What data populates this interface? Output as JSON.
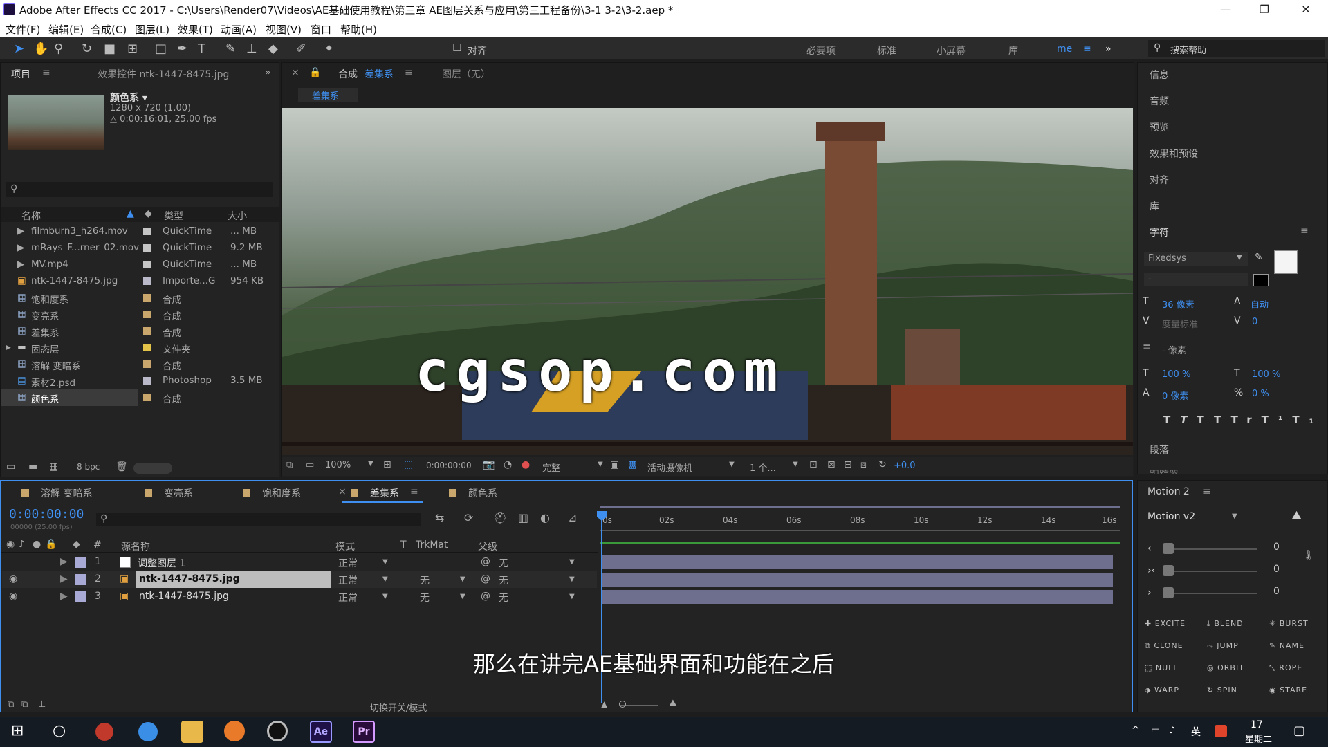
{
  "window": {
    "title": "Adobe After Effects CC 2017 - C:\\Users\\Render07\\Videos\\AE基础使用教程\\第三章 AE图层关系与应用\\第三工程备份\\3-1 3-2\\3-2.aep *",
    "minimize": "—",
    "restore": "❐",
    "close": "✕"
  },
  "menu": [
    "文件(F)",
    "编辑(E)",
    "合成(C)",
    "图层(L)",
    "效果(T)",
    "动画(A)",
    "视图(V)",
    "窗口",
    "帮助(H)"
  ],
  "toolbar": {
    "align_label": "对齐",
    "workspaces": [
      "必要项",
      "标准",
      "小屏幕",
      "库",
      "me"
    ],
    "search_placeholder": "搜索帮助"
  },
  "project": {
    "tab_label": "项目",
    "effects_tab": "效果控件 ntk-1447-8475.jpg",
    "preview_name": "颜色系 ▾",
    "preview_info1": "1280 x 720 (1.00)",
    "preview_info2": "△ 0:00:16:01, 25.00 fps",
    "col_name": "名称",
    "col_type": "类型",
    "col_size": "大小",
    "bpc": "8 bpc",
    "items": [
      {
        "name": "filmburn3_h264.mov",
        "type": "QuickTime",
        "size": "... MB",
        "color": "#a8a8a8"
      },
      {
        "name": "mRays_F...rner_02.mov",
        "type": "QuickTime",
        "size": "9.2 MB",
        "color": "#a8a8a8"
      },
      {
        "name": "MV.mp4",
        "type": "QuickTime",
        "size": "... MB",
        "color": "#a8a8a8"
      },
      {
        "name": "ntk-1447-8475.jpg",
        "type": "Importe...G",
        "size": "954 KB",
        "color": "#a8a8a8"
      },
      {
        "name": "饱和度系",
        "type": "合成",
        "size": "",
        "color": "#c9a66b"
      },
      {
        "name": "变亮系",
        "type": "合成",
        "size": "",
        "color": "#c9a66b"
      },
      {
        "name": "差集系",
        "type": "合成",
        "size": "",
        "color": "#c9a66b"
      },
      {
        "name": "固态层",
        "type": "文件夹",
        "size": "",
        "color": "#e3c449"
      },
      {
        "name": "溶解 变暗系",
        "type": "合成",
        "size": "",
        "color": "#c9a66b"
      },
      {
        "name": "素材2.psd",
        "type": "Photoshop",
        "size": "3.5 MB",
        "color": "#a8a8a8"
      },
      {
        "name": "颜色系",
        "type": "合成",
        "size": "",
        "color": "#c9a66b"
      }
    ]
  },
  "comp": {
    "tab_prefix": "合成",
    "tab_name": "差集系",
    "layer_tab": "图层（无）",
    "flow_label": "差集系",
    "zoom": "100%",
    "timecode": "0:00:00:00",
    "quality": "完整",
    "camera": "活动摄像机",
    "views": "1 个...",
    "exposure": "+0.0"
  },
  "viewer_overlay": "cgsop.com",
  "right_panel": {
    "items": [
      "信息",
      "音频",
      "预览",
      "效果和预设",
      "对齐",
      "库",
      "字符"
    ],
    "font": "Fixedsys",
    "font_style": "-",
    "size": "36 像素",
    "leading": "自动",
    "kerning": "度量标准",
    "tracking": "0",
    "stroke": "- 像素",
    "vscale": "100 %",
    "hscale": "100 %",
    "baseline": "0 像素",
    "tsume": "0 %",
    "paragraph": "段落",
    "tracker": "跟踪器"
  },
  "motion": {
    "title": "Motion 2",
    "version": "Motion v2",
    "values": [
      "0",
      "0",
      "0"
    ],
    "buttons": [
      "EXCITE",
      "BLEND",
      "BURST",
      "CLONE",
      "JUMP",
      "NAME",
      "NULL",
      "ORBIT",
      "ROPE",
      "WARP",
      "SPIN",
      "STARE"
    ]
  },
  "timeline": {
    "tabs": [
      "溶解 变暗系",
      "变亮系",
      "饱和度系",
      "差集系",
      "颜色系"
    ],
    "timecode": "0:00:00:00",
    "frame_info": "00000 (25.00 fps)",
    "headers": {
      "num": "#",
      "source": "源名称",
      "mode": "模式",
      "t": "T",
      "trkmat": "TrkMat",
      "parent": "父级"
    },
    "ruler": [
      "0s",
      "02s",
      "04s",
      "06s",
      "08s",
      "10s",
      "12s",
      "14s",
      "16s"
    ],
    "layers": [
      {
        "num": "1",
        "name": "调整图层 1",
        "mode": "正常",
        "trkmat": "",
        "parent": "无"
      },
      {
        "num": "2",
        "name": "ntk-1447-8475.jpg",
        "mode": "正常",
        "trkmat": "无",
        "parent": "无"
      },
      {
        "num": "3",
        "name": "ntk-1447-8475.jpg",
        "mode": "正常",
        "trkmat": "无",
        "parent": "无"
      }
    ],
    "toggle_label": "切换开关/模式"
  },
  "subtitle": "那么在讲完AE基础界面和功能在之后",
  "taskbar": {
    "time": "17",
    "date": "星期二",
    "ime": "英"
  }
}
